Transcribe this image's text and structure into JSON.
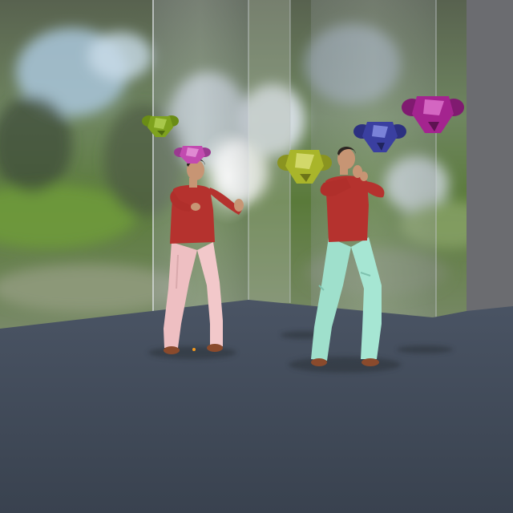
{
  "scene": {
    "description_free": true,
    "colors": {
      "floor": "#3b4452",
      "floor_far": "#465061",
      "backdrop_green": "#5f7a49",
      "sky_blue": "#9fc0d8",
      "shirt_red": "#b5322e",
      "pants_pink": "#eec0c2",
      "pants_mint": "#9fe0cc",
      "skin": "#c79574",
      "hair": "#2d2623",
      "shoe": "#8a4a2c",
      "monkey_green": "#7ea21e",
      "monkey_olive": "#a9b52a",
      "monkey_pink": "#c24bb0",
      "monkey_blue": "#3a3fa0",
      "monkey_magenta": "#a4248f",
      "wall_gray": "#6b6c70"
    },
    "objects": [
      {
        "name": "figure-left"
      },
      {
        "name": "figure-right"
      },
      {
        "name": "monkey-head-green"
      },
      {
        "name": "monkey-head-pink"
      },
      {
        "name": "monkey-head-olive"
      },
      {
        "name": "monkey-head-blue"
      },
      {
        "name": "monkey-head-magenta"
      }
    ]
  }
}
